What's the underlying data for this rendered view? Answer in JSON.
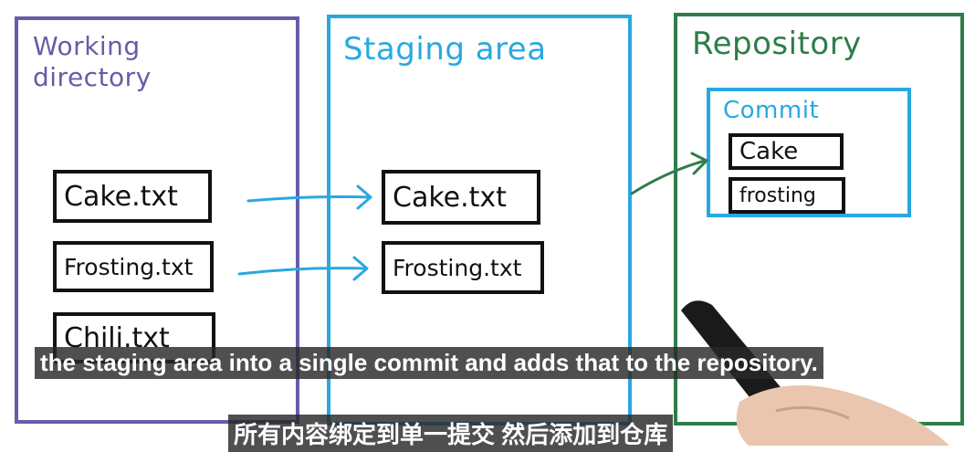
{
  "panels": {
    "working": {
      "title_line1": "Working",
      "title_line2": "directory",
      "color": "#6a5aa8"
    },
    "staging": {
      "title": "Staging area",
      "color": "#29a8e0"
    },
    "repository": {
      "title": "Repository",
      "color": "#2e7d4a"
    }
  },
  "files": {
    "working": [
      "Cake.txt",
      "Frosting.txt",
      "Chili.txt"
    ],
    "staging": [
      "Cake.txt",
      "Frosting.txt"
    ]
  },
  "commit": {
    "title": "Commit",
    "color": "#29a8e0",
    "items": [
      "Cake",
      "frosting"
    ]
  },
  "arrows": {
    "stage_color": "#29a8e0",
    "commit_color": "#2e7d4a"
  },
  "subtitles": {
    "english": "the staging area into a single commit and adds that to the repository.",
    "chinese": "所有内容绑定到单一提交 然后添加到仓库"
  }
}
